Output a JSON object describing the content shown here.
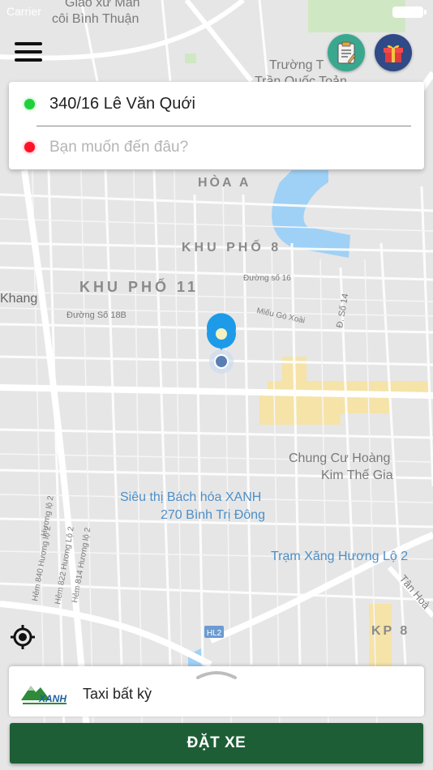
{
  "status_bar": {
    "carrier": "Carrier"
  },
  "map": {
    "labels": {
      "top_1": "Giáo xứ Mân",
      "top_2": "côi Bình Thuận",
      "school_1": "Trường T",
      "school_2": "Trần Quốc Toản",
      "hoa_a": "HÒA A",
      "khu_pho_8": "KHU PHỐ 8",
      "khu_pho_11": "KHU PHỐ 11",
      "khang": "Khang",
      "duong_so_18b": "Đường Số 18B",
      "duong_so_16": "Đường số 16",
      "mieu_go_xoai": "Miếu Gò Xoài",
      "d_so_14": "Đ. Số 14",
      "chung_cu_1": "Chung Cư Hoàng",
      "chung_cu_2": "Kim Thế Gia",
      "sieu_thi_1": "Siêu thị Bách hóa XANH",
      "sieu_thi_2": "270 Bình Trị Đông",
      "tram_xang": "Trạm Xăng Hương Lộ 2",
      "tan_hoa": "Tân Hoà",
      "kp8": "KP 8",
      "hl2": "HL2",
      "hem_840": "Hẻm 840 Hương lộ 2",
      "hem_822": "Hẻm 822 Hương Lộ 2",
      "hem_814": "Hẻm 814 Hương lộ 2",
      "huong_lo_2": "Hương lộ 2"
    }
  },
  "header": {
    "menu_icon": "hamburger-menu-icon",
    "history_icon": "clipboard-icon",
    "gift_icon": "gift-icon"
  },
  "trip": {
    "pickup_address": "340/16 Lê Văn Quới",
    "destination_value": "",
    "destination_placeholder": "Bạn muốn đến đâu?"
  },
  "service": {
    "logo_text": "XANH",
    "taxi_type": "Taxi bất kỳ"
  },
  "actions": {
    "book_label": "ĐẶT XE"
  },
  "colors": {
    "pickup_dot": "#1ed13a",
    "destination_dot": "#ff1128",
    "book_button": "#1e5e36",
    "pin": "#1e9be8",
    "water": "#9fd1f6"
  }
}
